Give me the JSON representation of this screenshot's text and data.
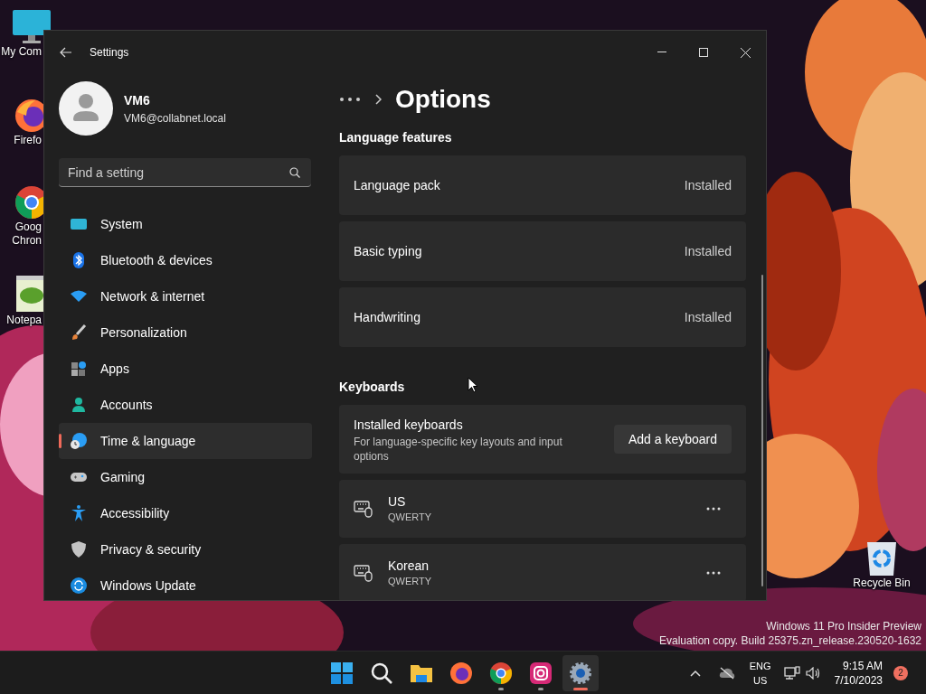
{
  "desktop": {
    "icons": [
      {
        "lines": [
          "My Com"
        ]
      },
      {
        "lines": [
          "Firefo"
        ]
      },
      {
        "lines": [
          "Goog",
          "Chron"
        ]
      },
      {
        "lines": [
          "Notepa"
        ]
      },
      {
        "lines": [
          "Recycle Bin"
        ]
      }
    ],
    "watermark": [
      "Windows 11 Pro Insider Preview",
      "Evaluation copy. Build 25375.zn_release.230520-1632"
    ]
  },
  "window": {
    "title": "Settings",
    "account": {
      "name": "VM6",
      "email": "VM6@collabnet.local"
    },
    "search": {
      "placeholder": "Find a setting"
    },
    "nav": [
      {
        "label": "System",
        "selected": false
      },
      {
        "label": "Bluetooth & devices",
        "selected": false
      },
      {
        "label": "Network & internet",
        "selected": false
      },
      {
        "label": "Personalization",
        "selected": false
      },
      {
        "label": "Apps",
        "selected": false
      },
      {
        "label": "Accounts",
        "selected": false
      },
      {
        "label": "Time & language",
        "selected": true
      },
      {
        "label": "Gaming",
        "selected": false
      },
      {
        "label": "Accessibility",
        "selected": false
      },
      {
        "label": "Privacy & security",
        "selected": false
      },
      {
        "label": "Windows Update",
        "selected": false
      }
    ],
    "page_title": "Options",
    "sections": [
      {
        "heading": "Language features",
        "rows": [
          {
            "kind": "feature",
            "label": "Language pack",
            "status": "Installed"
          },
          {
            "kind": "feature",
            "label": "Basic typing",
            "status": "Installed"
          },
          {
            "kind": "feature",
            "label": "Handwriting",
            "status": "Installed"
          }
        ]
      },
      {
        "heading": "Keyboards",
        "rows": [
          {
            "kind": "action",
            "title": "Installed keyboards",
            "description": "For language-specific key layouts and input options",
            "button": "Add a keyboard"
          },
          {
            "kind": "keyboard",
            "name": "US",
            "layout": "QWERTY"
          },
          {
            "kind": "keyboard",
            "name": "Korean",
            "layout": "QWERTY"
          }
        ]
      }
    ]
  },
  "taskbar": {
    "apps": [
      {
        "selected": false,
        "running": false
      },
      {
        "selected": false,
        "running": false
      },
      {
        "selected": false,
        "running": false
      },
      {
        "selected": false,
        "running": false
      },
      {
        "selected": false,
        "running": true
      },
      {
        "selected": false,
        "running": true
      },
      {
        "selected": true,
        "running": true
      }
    ],
    "language": [
      "ENG",
      "US"
    ],
    "time": "9:15 AM",
    "date": "7/10/2023",
    "notifications": "2"
  }
}
